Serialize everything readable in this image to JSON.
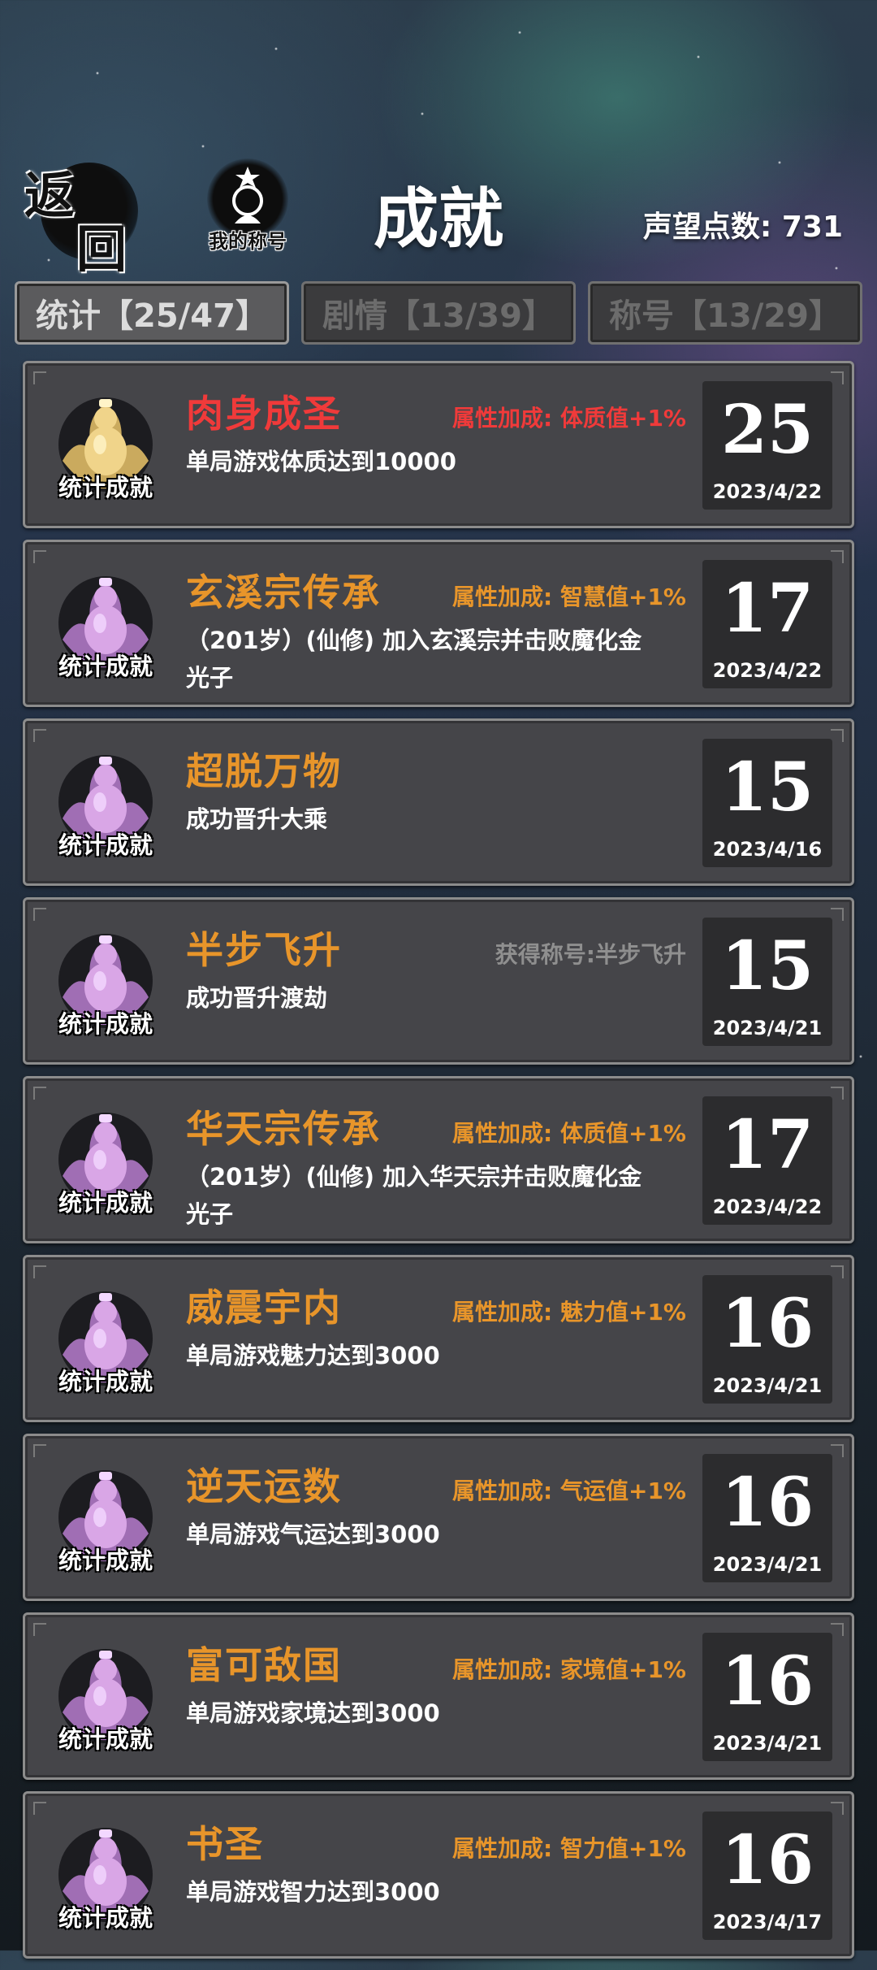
{
  "header": {
    "back_char_1": "返",
    "back_char_2": "回",
    "my_title_label": "我的称号",
    "page_title": "成就",
    "reputation": "声望点数: 731"
  },
  "tabs": [
    {
      "label": "统计【25/47】",
      "active": true
    },
    {
      "label": "剧情【13/39】",
      "active": false
    },
    {
      "label": "称号【13/29】",
      "active": false
    }
  ],
  "achievements": [
    {
      "name": "肉身成圣",
      "bonus": "属性加成: 体质值+1%",
      "desc": "单局游戏体质达到10000",
      "score": "25",
      "date": "2023/4/22",
      "badge": "统计成就",
      "icon": "golden-gourd-icon"
    },
    {
      "name": "玄溪宗传承",
      "bonus": "属性加成: 智慧值+1%",
      "desc": "（201岁）(仙修) 加入玄溪宗并击败魔化金光子",
      "score": "17",
      "date": "2023/4/22",
      "badge": "统计成就",
      "icon": "purple-gourd-icon"
    },
    {
      "name": "超脱万物",
      "bonus": "",
      "desc": "成功晋升大乘",
      "score": "15",
      "date": "2023/4/16",
      "badge": "统计成就",
      "icon": "purple-gourd-icon"
    },
    {
      "name": "半步飞升",
      "bonus": "获得称号:半步飞升",
      "desc": "成功晋升渡劫",
      "score": "15",
      "date": "2023/4/21",
      "badge": "统计成就",
      "icon": "purple-gourd-icon"
    },
    {
      "name": "华天宗传承",
      "bonus": "属性加成: 体质值+1%",
      "desc": "（201岁）(仙修) 加入华天宗并击败魔化金光子",
      "score": "17",
      "date": "2023/4/22",
      "badge": "统计成就",
      "icon": "purple-gourd-icon"
    },
    {
      "name": "威震宇内",
      "bonus": "属性加成: 魅力值+1%",
      "desc": "单局游戏魅力达到3000",
      "score": "16",
      "date": "2023/4/21",
      "badge": "统计成就",
      "icon": "purple-gourd-icon"
    },
    {
      "name": "逆天运数",
      "bonus": "属性加成: 气运值+1%",
      "desc": "单局游戏气运达到3000",
      "score": "16",
      "date": "2023/4/21",
      "badge": "统计成就",
      "icon": "purple-gourd-icon"
    },
    {
      "name": "富可敌国",
      "bonus": "属性加成: 家境值+1%",
      "desc": "单局游戏家境达到3000",
      "score": "16",
      "date": "2023/4/21",
      "badge": "统计成就",
      "icon": "purple-gourd-icon"
    },
    {
      "name": "书圣",
      "bonus": "属性加成: 智力值+1%",
      "desc": "单局游戏智力达到3000",
      "score": "16",
      "date": "2023/4/17",
      "badge": "统计成就",
      "icon": "purple-gourd-icon"
    }
  ],
  "colors": {
    "name_orange": "#e8952a",
    "name_red": "#f03a3a",
    "bonus_gray": "#8f8f8f",
    "card_bg": "#454549",
    "score_bg": "#2c2c2e"
  }
}
